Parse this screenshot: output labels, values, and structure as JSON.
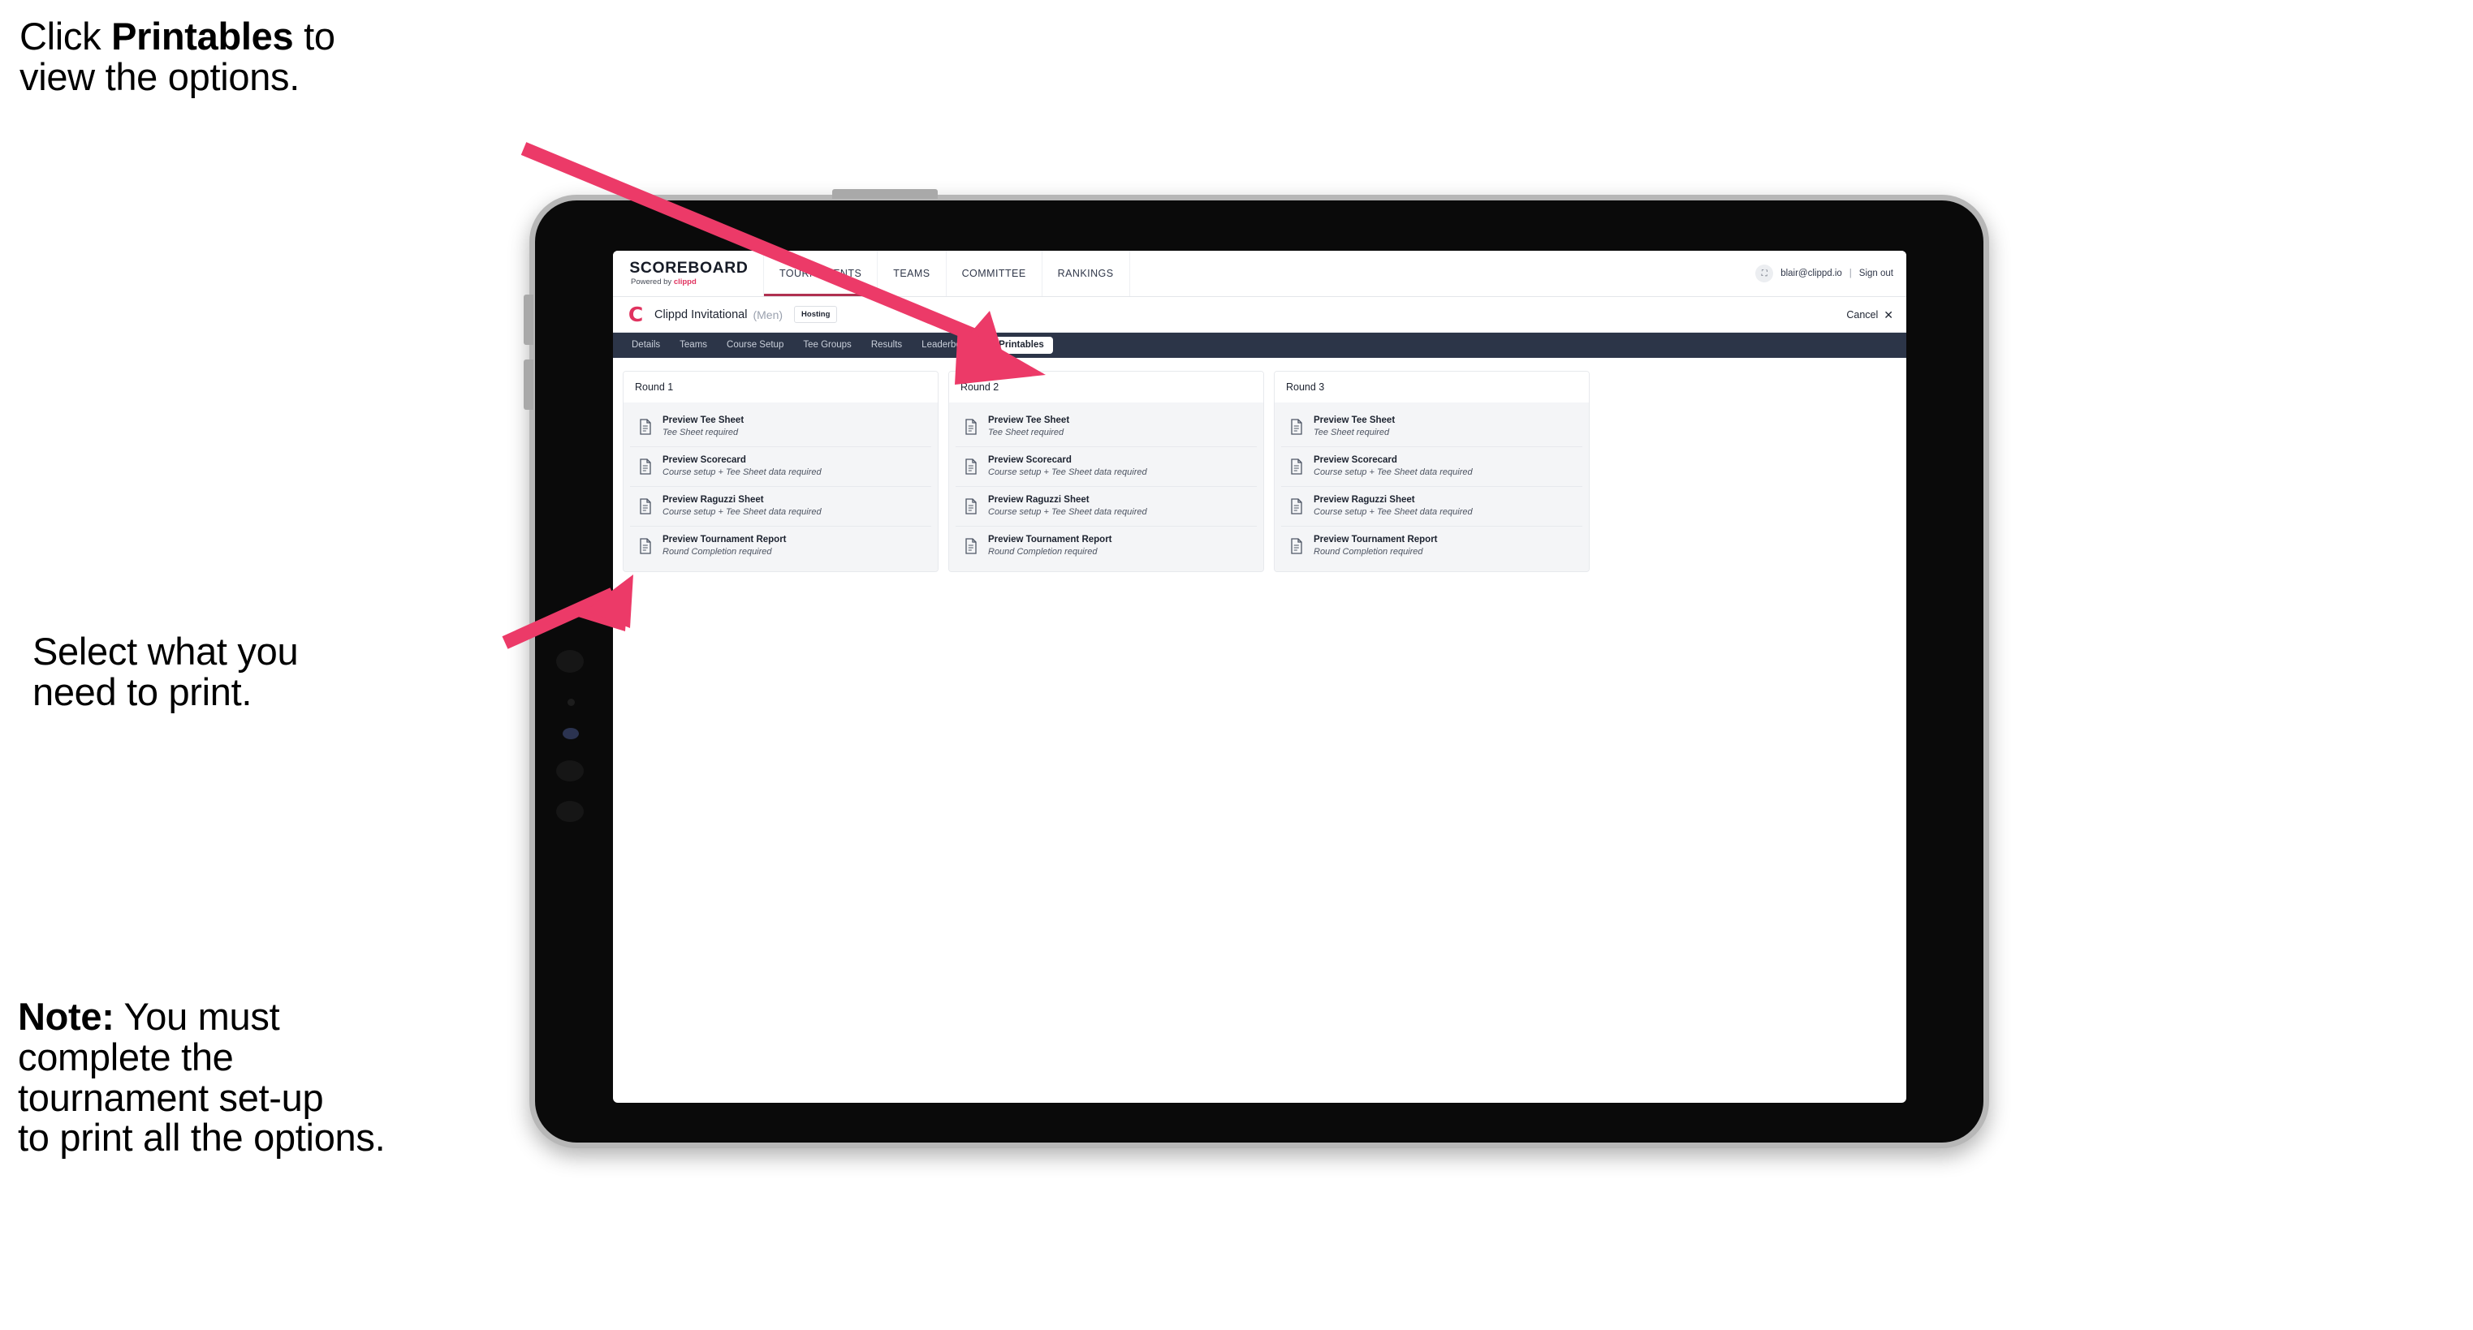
{
  "colors": {
    "accent_pink": "#EC3A68",
    "navy": "#2C3548",
    "brand_red": "#E0335F",
    "card_bg": "#F4F5F7"
  },
  "annotations": {
    "top_prefix": "Click ",
    "top_bold": "Printables",
    "top_suffix": " to\nview the options.",
    "middle": "Select what you\n need to print.",
    "note_bold": "Note:",
    "note_rest": " You must\ncomplete the\ntournament set-up\nto print all the options."
  },
  "device": {
    "power_button_label": "power-button",
    "volume_up_label": "volume-up-button",
    "volume_down_label": "volume-down-button"
  },
  "app": {
    "brand": {
      "wordmark": "SCOREBOARD",
      "powered_by_prefix": "Powered by ",
      "powered_by_name": "clippd"
    },
    "topnav": [
      {
        "label": "TOURNAMENTS",
        "active": true
      },
      {
        "label": "TEAMS",
        "active": false
      },
      {
        "label": "COMMITTEE",
        "active": false
      },
      {
        "label": "RANKINGS",
        "active": false
      }
    ],
    "account": {
      "avatar_glyph": "⛶",
      "email": "blair@clippd.io",
      "separator": "|",
      "sign_out": "Sign out"
    },
    "tournament": {
      "mark": "C",
      "name": "Clippd Invitational",
      "gender": "(Men)",
      "badge": "Hosting",
      "cancel_label": "Cancel",
      "cancel_icon": "✕"
    },
    "subnav": [
      {
        "label": "Details",
        "active": false
      },
      {
        "label": "Teams",
        "active": false
      },
      {
        "label": "Course Setup",
        "active": false
      },
      {
        "label": "Tee Groups",
        "active": false
      },
      {
        "label": "Results",
        "active": false
      },
      {
        "label": "Leaderboards",
        "active": false
      },
      {
        "label": "Printables",
        "active": true
      }
    ],
    "rounds": [
      {
        "title": "Round 1",
        "items": [
          {
            "title": "Preview Tee Sheet",
            "sub": "Tee Sheet required"
          },
          {
            "title": "Preview Scorecard",
            "sub": "Course setup + Tee Sheet data required"
          },
          {
            "title": "Preview Raguzzi Sheet",
            "sub": "Course setup + Tee Sheet data required"
          },
          {
            "title": "Preview Tournament Report",
            "sub": "Round Completion required"
          }
        ]
      },
      {
        "title": "Round 2",
        "items": [
          {
            "title": "Preview Tee Sheet",
            "sub": "Tee Sheet required"
          },
          {
            "title": "Preview Scorecard",
            "sub": "Course setup + Tee Sheet data required"
          },
          {
            "title": "Preview Raguzzi Sheet",
            "sub": "Course setup + Tee Sheet data required"
          },
          {
            "title": "Preview Tournament Report",
            "sub": "Round Completion required"
          }
        ]
      },
      {
        "title": "Round 3",
        "items": [
          {
            "title": "Preview Tee Sheet",
            "sub": "Tee Sheet required"
          },
          {
            "title": "Preview Scorecard",
            "sub": "Course setup + Tee Sheet data required"
          },
          {
            "title": "Preview Raguzzi Sheet",
            "sub": "Course setup + Tee Sheet data required"
          },
          {
            "title": "Preview Tournament Report",
            "sub": "Round Completion required"
          }
        ]
      }
    ]
  }
}
